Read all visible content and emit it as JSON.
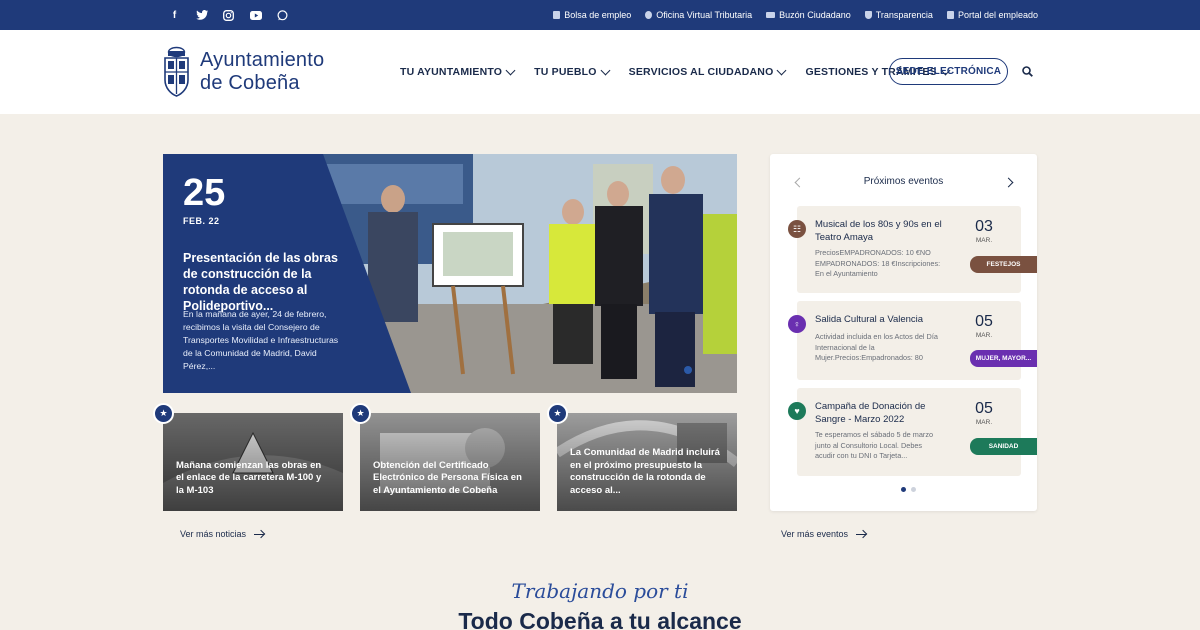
{
  "social": [
    "facebook-icon",
    "twitter-icon",
    "instagram-icon",
    "youtube-icon",
    "whatsapp-icon"
  ],
  "toplinks": [
    {
      "label": "Bolsa de empleo",
      "icon": "briefcase-icon"
    },
    {
      "label": "Oficina Virtual Tributaria",
      "icon": "globe-icon"
    },
    {
      "label": "Buzón Ciudadano",
      "icon": "mail-icon"
    },
    {
      "label": "Transparencia",
      "icon": "shield-icon"
    },
    {
      "label": "Portal del empleado",
      "icon": "portal-icon"
    }
  ],
  "header": {
    "logo_line1": "Ayuntamiento",
    "logo_line2": "de Cobeña",
    "nav": [
      {
        "label": "TU AYUNTAMIENTO"
      },
      {
        "label": "TU PUEBLO"
      },
      {
        "label": "SERVICIOS AL CIUDADANO"
      },
      {
        "label": "GESTIONES Y TRÁMITES"
      }
    ],
    "sede_label": "SEDE ELECTRÓNICA"
  },
  "hero": {
    "day": "25",
    "month": "FEB. 22",
    "title": "Presentación de las obras de construcción de la rotonda de acceso al Polideportivo...",
    "text": "En la mañana de ayer, 24 de febrero, recibimos la visita del Consejero de Transportes Movilidad e Infraestructuras de la Comunidad de Madrid, David Pérez,..."
  },
  "news": [
    {
      "title": "Mañana comienzan las obras en el enlace de la carretera M-100 y la M-103"
    },
    {
      "title": "Obtención del Certificado Electrónico de Persona Física en el Ayuntamiento de Cobeña"
    },
    {
      "title": "La Comunidad de Madrid incluirá en el próximo presupuesto la construcción de la rotonda de acceso al..."
    }
  ],
  "more_news": "Ver más noticias",
  "events": {
    "heading": "Próximos eventos",
    "items": [
      {
        "title": "Musical de los 80s y 90s en el Teatro Amaya",
        "desc": "PreciosEMPADRONADOS: 10 €NO EMPADRONADOS: 18 €Inscripciones: En el Ayuntamiento",
        "day": "03",
        "month": "MAR.",
        "tag": "FESTEJOS",
        "color": "#7a5140"
      },
      {
        "title": "Salida Cultural a Valencia",
        "desc": "Actividad incluida en los Actos del Día Internacional de la Mujer.Precios:Empadronados: 80",
        "day": "05",
        "month": "MAR.",
        "tag": "MUJER, MAYOR...",
        "color": "#6a2fb0"
      },
      {
        "title": "Campaña de Donación de Sangre - Marzo 2022",
        "desc": "Te esperamos el sábado 5 de marzo junto al Consultorio Local. Debes acudir con tu DNI o Tarjeta...",
        "day": "05",
        "month": "MAR.",
        "tag": "SANIDAD",
        "color": "#1d7a5a"
      }
    ]
  },
  "more_events": "Ver más eventos",
  "bottom": {
    "tagline": "Trabajando por ti",
    "title": "Todo Cobeña a tu alcance"
  }
}
